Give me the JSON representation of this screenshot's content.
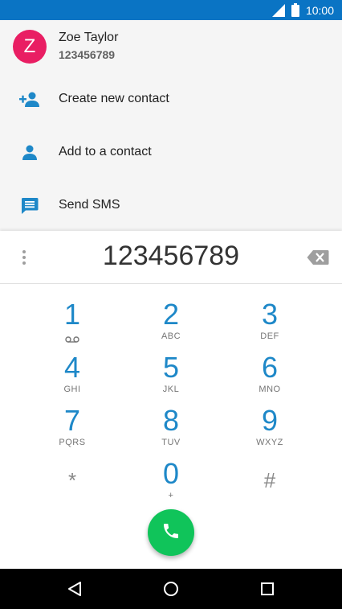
{
  "status_bar": {
    "time": "10:00"
  },
  "suggestion": {
    "avatar_letter": "Z",
    "name": "Zoe Taylor",
    "number": "123456789"
  },
  "actions": [
    {
      "label": "Create new contact",
      "icon": "add-person-icon"
    },
    {
      "label": "Add to a contact",
      "icon": "person-icon"
    },
    {
      "label": "Send SMS",
      "icon": "message-icon"
    }
  ],
  "digits": "123456789",
  "keys": [
    {
      "num": "1",
      "letters": ""
    },
    {
      "num": "2",
      "letters": "ABC"
    },
    {
      "num": "3",
      "letters": "DEF"
    },
    {
      "num": "4",
      "letters": "GHI"
    },
    {
      "num": "5",
      "letters": "JKL"
    },
    {
      "num": "6",
      "letters": "MNO"
    },
    {
      "num": "7",
      "letters": "PQRS"
    },
    {
      "num": "8",
      "letters": "TUV"
    },
    {
      "num": "9",
      "letters": "WXYZ"
    },
    {
      "num": "*",
      "letters": ""
    },
    {
      "num": "0",
      "letters": "+"
    },
    {
      "num": "#",
      "letters": ""
    }
  ],
  "colors": {
    "status_bar": "#0a74c4",
    "accent": "#1e88c8",
    "avatar": "#e91e63",
    "call_button": "#10c45a"
  }
}
